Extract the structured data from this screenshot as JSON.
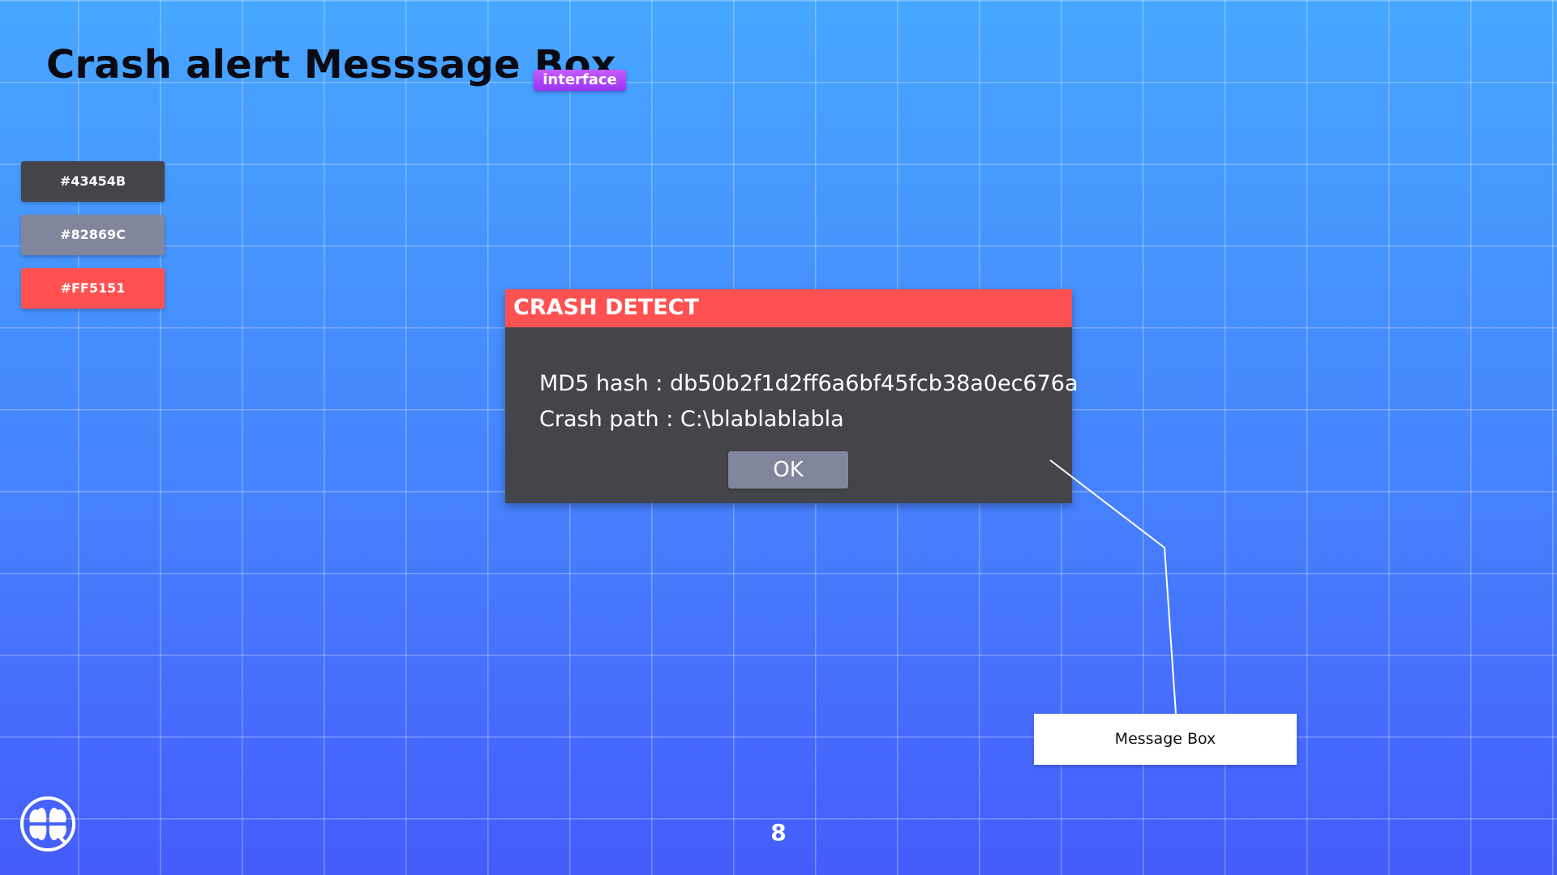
{
  "slide": {
    "title": "Crash alert Messsage Box",
    "tag": "interface",
    "page_number": "8"
  },
  "palette": [
    {
      "label": "#43454B",
      "color": "#43454B"
    },
    {
      "label": "#82869C",
      "color": "#82869C"
    },
    {
      "label": "#FF5151",
      "color": "#FF5151"
    }
  ],
  "dialog": {
    "title": "CRASH DETECT",
    "md5_line": "MD5 hash : db50b2f1d2ff6a6bf45fcb38a0ec676a",
    "path_line": "Crash path : C:\\blablablabla",
    "ok_label": "OK"
  },
  "callout": {
    "label": "Message Box"
  },
  "icons": {
    "logo": "clover-logo-icon"
  },
  "colors": {
    "dialog_background": "#43454B",
    "button_background": "#82869C",
    "header_background": "#FF5151",
    "tag_background": "#B44CFA"
  }
}
